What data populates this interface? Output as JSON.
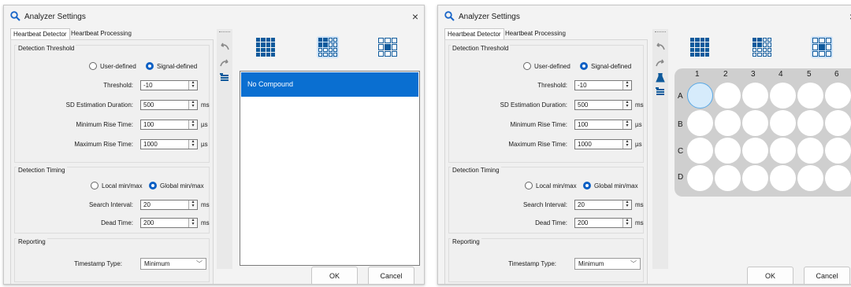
{
  "windows": [
    {
      "title": "Analyzer Settings",
      "tabs": [
        "Heartbeat Detector",
        "Heartbeat Processing"
      ],
      "detection_threshold": {
        "title": "Detection Threshold",
        "radio_user": "User-defined",
        "radio_signal": "Signal-defined",
        "threshold_label": "Threshold:",
        "threshold_value": "-10",
        "sd_label": "SD Estimation Duration:",
        "sd_value": "500",
        "sd_unit": "ms",
        "min_rise_label": "Minimum Rise Time:",
        "min_rise_value": "100",
        "min_rise_unit": "µs",
        "max_rise_label": "Maximum Rise Time:",
        "max_rise_value": "1000",
        "max_rise_unit": "µs"
      },
      "detection_timing": {
        "title": "Detection Timing",
        "radio_local": "Local min/max",
        "radio_global": "Global min/max",
        "search_label": "Search Interval:",
        "search_value": "20",
        "search_unit": "ms",
        "dead_label": "Dead Time:",
        "dead_value": "200",
        "dead_unit": "ms"
      },
      "reporting": {
        "title": "Reporting",
        "timestamp_label": "Timestamp Type:",
        "timestamp_value": "Minimum"
      },
      "list_item": "No Compound",
      "ok": "OK",
      "cancel": "Cancel",
      "close": "×"
    },
    {
      "title": "Analyzer Settings",
      "tabs": [
        "Heartbeat Detector",
        "Heartbeat Processing"
      ],
      "detection_threshold": {
        "title": "Detection Threshold",
        "radio_user": "User-defined",
        "radio_signal": "Signal-defined",
        "threshold_label": "Threshold:",
        "threshold_value": "-10",
        "sd_label": "SD Estimation Duration:",
        "sd_value": "500",
        "sd_unit": "ms",
        "min_rise_label": "Minimum Rise Time:",
        "min_rise_value": "100",
        "min_rise_unit": "µs",
        "max_rise_label": "Maximum Rise Time:",
        "max_rise_value": "1000",
        "max_rise_unit": "µs"
      },
      "detection_timing": {
        "title": "Detection Timing",
        "radio_local": "Local min/max",
        "radio_global": "Global min/max",
        "search_label": "Search Interval:",
        "search_value": "20",
        "search_unit": "ms",
        "dead_label": "Dead Time:",
        "dead_value": "200",
        "dead_unit": "ms"
      },
      "reporting": {
        "title": "Reporting",
        "timestamp_label": "Timestamp Type:",
        "timestamp_value": "Minimum"
      },
      "plate": {
        "columns": [
          "1",
          "2",
          "3",
          "4",
          "5",
          "6"
        ],
        "rows": [
          "A",
          "B",
          "C",
          "D"
        ],
        "selected_well": "A1"
      },
      "ok": "OK",
      "cancel": "Cancel",
      "close": "×"
    }
  ],
  "colors": {
    "accent": "#0a6fd1",
    "icon_blue": "#0f5a9c",
    "selected_layout_bg": "#cfe3f7",
    "plate": "#cfcfcf"
  },
  "icons": [
    "search-icon",
    "undo-icon",
    "redo-icon",
    "compound-list-icon",
    "flask-icon",
    "grid-full-icon",
    "grid-partial-icon",
    "grid-outline-icon"
  ]
}
